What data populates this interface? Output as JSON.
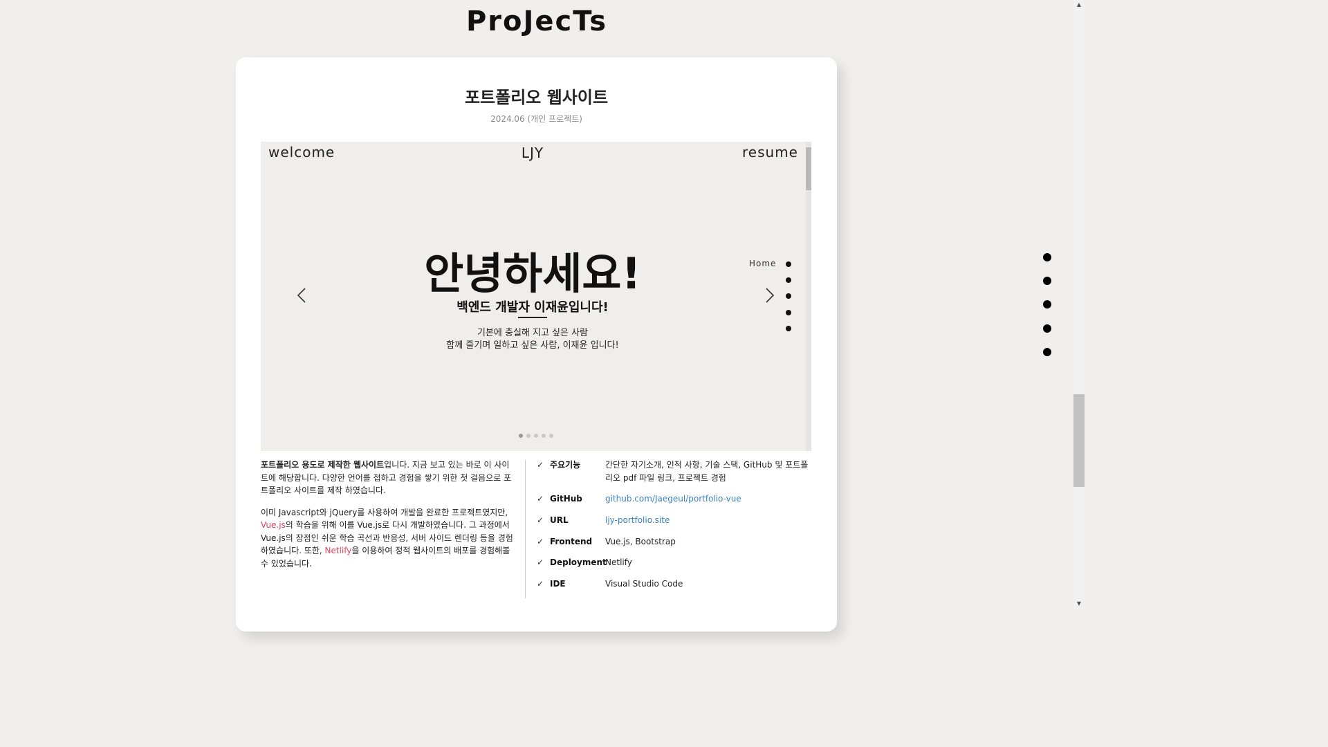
{
  "section": {
    "title": "ProJecTs"
  },
  "project": {
    "title": "포트폴리오 웹사이트",
    "date": "2024.06 (개인 프로젝트)"
  },
  "preview": {
    "nav": {
      "welcome": "welcome",
      "brand": "LJY",
      "resume": "resume"
    },
    "headline": "안녕하세요!",
    "subtitle": "백엔드 개발자 이재윤입니다!",
    "description_line1": "기본에 충실해 지고 싶은 사람",
    "description_line2": "함께 즐기며 일하고 싶은 사람, 이재윤 입니다!",
    "section_label": "Home",
    "prev_arrow": "‹",
    "next_arrow": "›",
    "page_count": 5,
    "active_page": 1
  },
  "description": {
    "para1_bold": "포트폴리오 용도로 제작한 웹사이트",
    "para1_rest": "입니다. 지금 보고 있는 바로 이 사이트에 해당합니다. 다양한 언어를 접하고 경험을 쌓기 위한 첫 걸음으로 포트폴리오 사이트를 제작 하였습니다.",
    "para2_a": "이미 Javascript와 jQuery를 사용하여 개발을 완료한 프로젝트였지만, ",
    "para2_hl1": "Vue.js",
    "para2_b": "의 학습을 위해 이를 Vue.js로 다시 개발하였습니다. 그 과정에서 Vue.js의 장점인 쉬운 학습 곡선과 반응성, 서버 사이드 렌더링 등을 경험하였습니다. 또한, ",
    "para2_hl2": "Netlify",
    "para2_c": "을 이용하여 정적 웹사이트의 배포를 경험해볼 수 있었습니다."
  },
  "features": [
    {
      "label": "주요기능",
      "value": "간단한 자기소개, 인적 사항, 기술 스택, GitHub 및 포트폴리오 pdf 파일 링크, 프로젝트 경험",
      "link": false
    },
    {
      "label": "GitHub",
      "value": "github.com/Jaegeul/portfolio-vue",
      "link": true
    },
    {
      "label": "URL",
      "value": "ljy-portfolio.site",
      "link": true
    },
    {
      "label": "Frontend",
      "value": "Vue.js, Bootstrap",
      "link": false
    },
    {
      "label": "Deployment",
      "value": "Netlify",
      "link": false
    },
    {
      "label": "IDE",
      "value": "Visual Studio Code",
      "link": false
    }
  ],
  "check_glyph": "✓",
  "colors": {
    "highlight": "#e0435e",
    "link": "#3a82c4",
    "background": "#f0efed"
  }
}
